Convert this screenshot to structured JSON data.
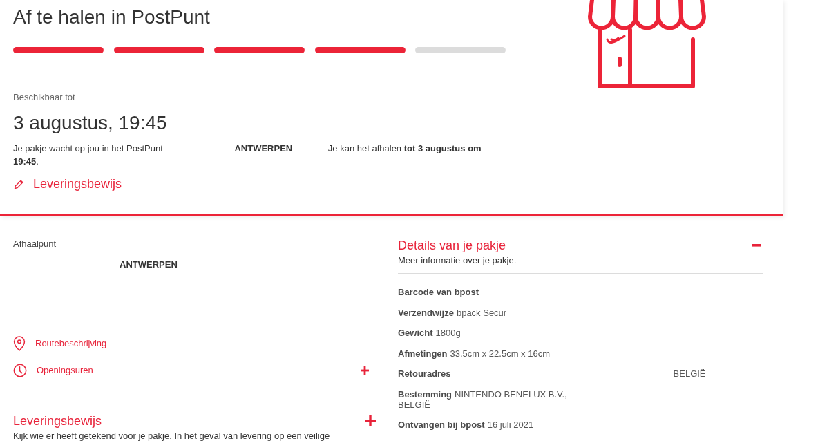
{
  "header": {
    "title": "Af te halen in PostPunt",
    "progress": [
      {
        "completed": true
      },
      {
        "completed": true
      },
      {
        "completed": true
      },
      {
        "completed": true
      },
      {
        "completed": false
      }
    ]
  },
  "availability": {
    "label": "Beschikbaar tot",
    "date": "3 augustus, 19:45"
  },
  "notice": {
    "intro": "Je pakje wacht op jou in het PostPunt",
    "city": "ANTWERPEN",
    "deadline": "Je kan het afhalen **tot 3 augustus om 19:45**."
  },
  "proof_link": {
    "label": "Leveringsbewijs"
  },
  "pickup_point": {
    "heading": "Afhaalpunt",
    "city": "ANTWERPEN",
    "links": [
      {
        "label": "Routebeschrijving",
        "kind": "route"
      },
      {
        "label": "Openingsuren",
        "kind": "hours",
        "expanded": false
      }
    ]
  },
  "proof_section": {
    "title": "Leveringsbewijs",
    "expanded": false,
    "description": "Kijk wie er heeft getekend voor je pakje. In het geval van levering op een veilige"
  },
  "details": {
    "title": "Details van je pakje",
    "subtitle": "Meer informatie over je pakje.",
    "expanded": true,
    "rows": [
      {
        "label": "Barcode van bpost",
        "kind": "inline"
      },
      {
        "label": "Verzendwijze",
        "kind": "inline",
        "values": [
          "bpack Secur"
        ]
      },
      {
        "label": "Gewicht",
        "kind": "inline",
        "values": [
          "1800g"
        ]
      },
      {
        "label": "Afmetingen",
        "kind": "inline",
        "values": [
          "33.5cm x 22.5cm x 16cm"
        ]
      },
      {
        "label": "Retouradres",
        "kind": "gapped",
        "values": [
          "BELGIË"
        ]
      },
      {
        "label": "Bestemming",
        "kind": "inline",
        "values": [
          "NINTENDO BENELUX B.V.,",
          "BELGIË"
        ]
      },
      {
        "label": "Ontvangen bij bpost",
        "kind": "inline",
        "values": [
          "16 juli 2021"
        ]
      }
    ]
  }
}
